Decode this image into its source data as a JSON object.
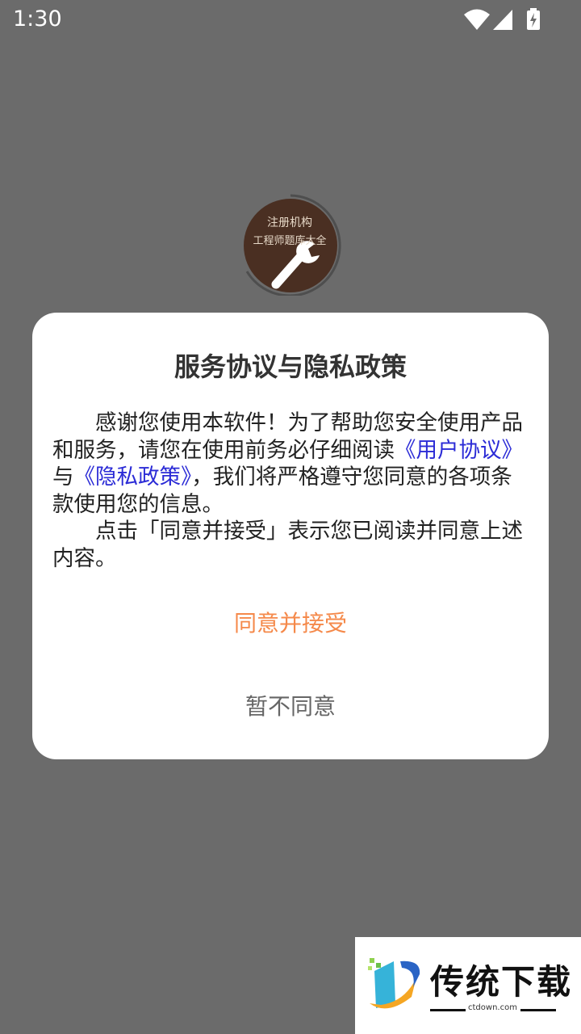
{
  "status_bar": {
    "time": "1:30",
    "icons": [
      "wifi-icon",
      "signal-icon",
      "battery-charging-icon"
    ]
  },
  "logo": {
    "line1": "注册机构",
    "line2": "工程师题库大全",
    "icon": "wrench-icon"
  },
  "dialog": {
    "title": "服务协议与隐私政策",
    "para1_part1": "感谢您使用本软件！为了帮助您安全使用产品和服务，请您在使用前务必仔细阅读",
    "user_agreement_link": "《用户协议》",
    "para1_part2": "与",
    "privacy_policy_link": "《隐私政策》",
    "para1_part3": "，我们将严格遵守您同意的各项条款使用您的信息。",
    "para2": "点击「同意并接受」表示您已阅读并同意上述内容。",
    "accept_label": "同意并接受",
    "decline_label": "暂不同意"
  },
  "watermark": {
    "text": "传统下载",
    "url": "ctdown.com"
  },
  "colors": {
    "overlay": "#6b6b6b",
    "accent": "#f5894a",
    "link": "#2b2bd6",
    "logo_brown": "#4a2f22"
  }
}
